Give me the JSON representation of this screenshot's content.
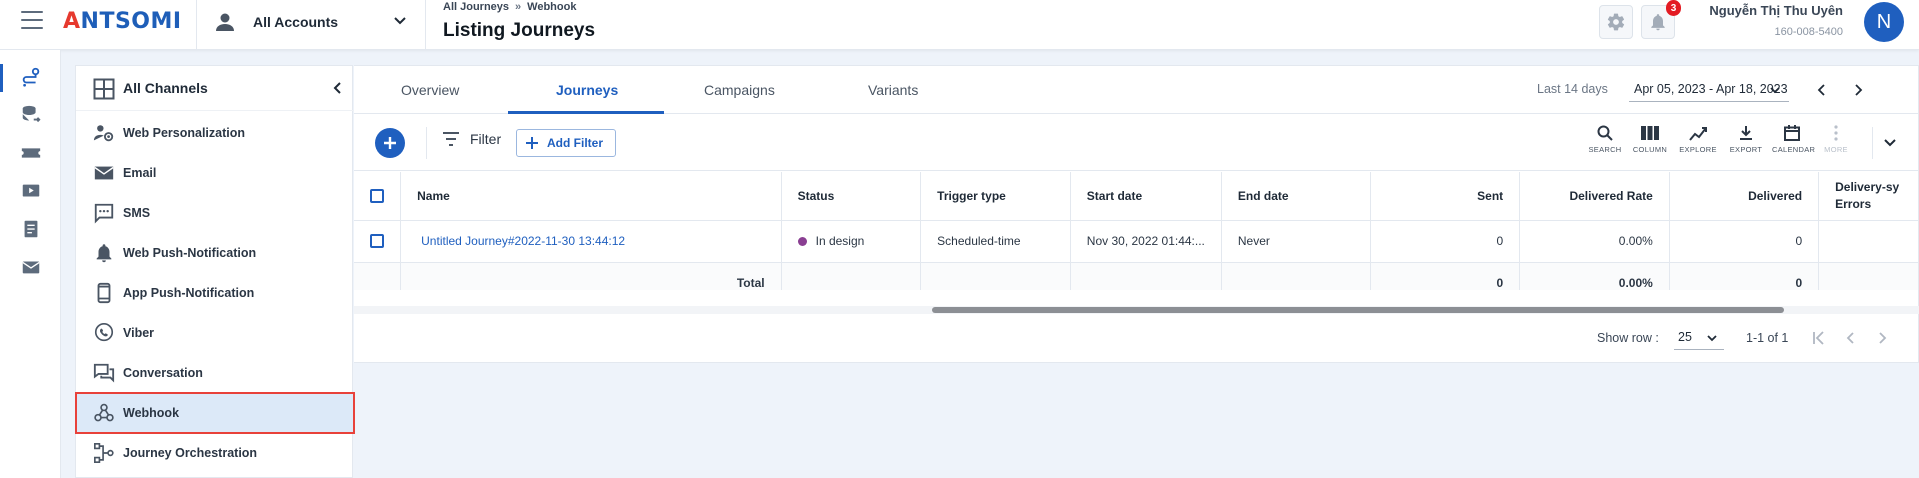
{
  "header": {
    "logo_prefix": "A",
    "logo_rest": "NTSOMI",
    "account": "All Accounts",
    "breadcrumb": [
      "All Journeys",
      "»",
      "Webhook"
    ],
    "page_title": "Listing Journeys",
    "notifications_count": "3",
    "user_name": "Nguyễn Thị Thu Uyên",
    "user_id": "160-008-5400",
    "avatar_initial": "N"
  },
  "rail": {
    "items": [
      {
        "icon": "journey-icon",
        "active": true
      },
      {
        "icon": "database-icon",
        "active": false
      },
      {
        "icon": "ticket-icon",
        "active": false
      },
      {
        "icon": "media-icon",
        "active": false
      },
      {
        "icon": "report-icon",
        "active": false
      },
      {
        "icon": "mail-icon",
        "active": false
      }
    ]
  },
  "channels": {
    "title": "All Channels",
    "items": [
      {
        "label": "Web Personalization",
        "icon": "web-personalization-icon"
      },
      {
        "label": "Email",
        "icon": "email-icon"
      },
      {
        "label": "SMS",
        "icon": "sms-icon"
      },
      {
        "label": "Web Push-Notification",
        "icon": "bell-icon"
      },
      {
        "label": "App Push-Notification",
        "icon": "phone-icon"
      },
      {
        "label": "Viber",
        "icon": "viber-icon"
      },
      {
        "label": "Conversation",
        "icon": "conversation-icon"
      },
      {
        "label": "Webhook",
        "icon": "webhook-icon",
        "selected": true
      },
      {
        "label": "Journey Orchestration",
        "icon": "orchestration-icon"
      }
    ]
  },
  "tabs": [
    {
      "label": "Overview"
    },
    {
      "label": "Journeys",
      "active": true
    },
    {
      "label": "Campaigns"
    },
    {
      "label": "Variants"
    }
  ],
  "date": {
    "caption": "Last 14 days",
    "range": "Apr 05, 2023 - Apr 18, 2023"
  },
  "toolbar": {
    "filter_label": "Filter",
    "add_filter_label": "Add Filter",
    "tools": [
      {
        "label": "SEARCH",
        "icon": "search-icon"
      },
      {
        "label": "COLUMN",
        "icon": "column-icon"
      },
      {
        "label": "EXPLORE",
        "icon": "explore-icon"
      },
      {
        "label": "EXPORT",
        "icon": "export-icon"
      },
      {
        "label": "CALENDAR",
        "icon": "calendar-icon"
      },
      {
        "label": "MORE",
        "icon": "more-icon",
        "disabled": true
      }
    ]
  },
  "table": {
    "columns": [
      "Name",
      "Status",
      "Trigger type",
      "Start date",
      "End date",
      "Sent",
      "Delivered Rate",
      "Delivered",
      "Delivery-sy Errors"
    ],
    "rows": [
      {
        "name": "Untitled Journey#2022-11-30 13:44:12",
        "status": "In design",
        "status_color": "#8a3f92",
        "trigger": "Scheduled-time",
        "start": "Nov 30, 2022 01:44:...",
        "end": "Never",
        "sent": "0",
        "delivered_rate": "0.00%",
        "delivered": "0",
        "errors": ""
      }
    ],
    "total": {
      "label": "Total",
      "sent": "0",
      "delivered_rate": "0.00%",
      "delivered": "0"
    }
  },
  "pager": {
    "show_row_label": "Show row :",
    "rows_value": "25",
    "range": "1-1 of 1"
  },
  "colors": {
    "brand": "#1f5fbf",
    "logo_accent": "#e6392e",
    "badge": "#e31b23",
    "selection_outline": "#e8413a",
    "status_in_design": "#8a3f92"
  }
}
